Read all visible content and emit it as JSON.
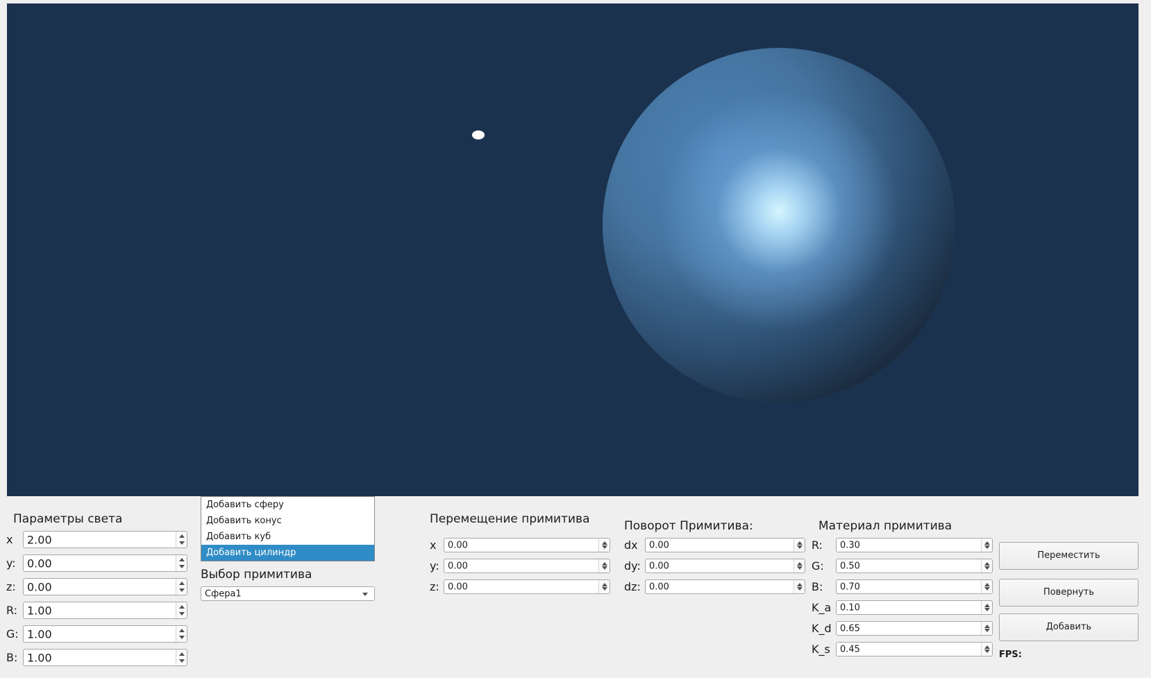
{
  "viewport": {
    "background_color": "#1b324e",
    "sphere_color": "#4d82b7",
    "light_color": "#ffffff"
  },
  "light_params": {
    "title": "Параметры света",
    "fields": [
      {
        "label": "x",
        "value": "2.00"
      },
      {
        "label": "y:",
        "value": "0.00"
      },
      {
        "label": "z:",
        "value": "0.00"
      },
      {
        "label": "R:",
        "value": "1.00"
      },
      {
        "label": "G:",
        "value": "1.00"
      },
      {
        "label": "B:",
        "value": "1.00"
      }
    ]
  },
  "primitive_select": {
    "dropdown_options": [
      "Добавить сферу",
      "Добавить конус",
      "Добавить куб",
      "Добавить цилиндр"
    ],
    "highlighted_option": "Добавить цилиндр",
    "title": "Выбор примитива",
    "combo_value": "Сфера1"
  },
  "move_primitive": {
    "title": "Перемещение примитива",
    "fields": [
      {
        "label": "x",
        "value": "0.00"
      },
      {
        "label": "y:",
        "value": "0.00"
      },
      {
        "label": "z:",
        "value": "0.00"
      }
    ]
  },
  "rotate_primitive": {
    "title": "Поворот Примитива:",
    "fields": [
      {
        "label": "dx",
        "value": "0.00"
      },
      {
        "label": "dy:",
        "value": "0.00"
      },
      {
        "label": "dz:",
        "value": "0.00"
      }
    ]
  },
  "material": {
    "title": "Материал примитива",
    "fields": [
      {
        "label": "R:",
        "value": "0.30"
      },
      {
        "label": "G:",
        "value": "0.50"
      },
      {
        "label": "B:",
        "value": "0.70"
      },
      {
        "label": "K_a",
        "value": "0.10"
      },
      {
        "label": "K_d",
        "value": "0.65"
      },
      {
        "label": "K_s",
        "value": "0.45"
      }
    ]
  },
  "buttons": {
    "move": "Переместить",
    "rotate": "Повернуть",
    "add": "Добавить"
  },
  "fps_label": "FPS:",
  "colors": {
    "selection": "#308cc6",
    "panel_bg": "#efefef"
  }
}
